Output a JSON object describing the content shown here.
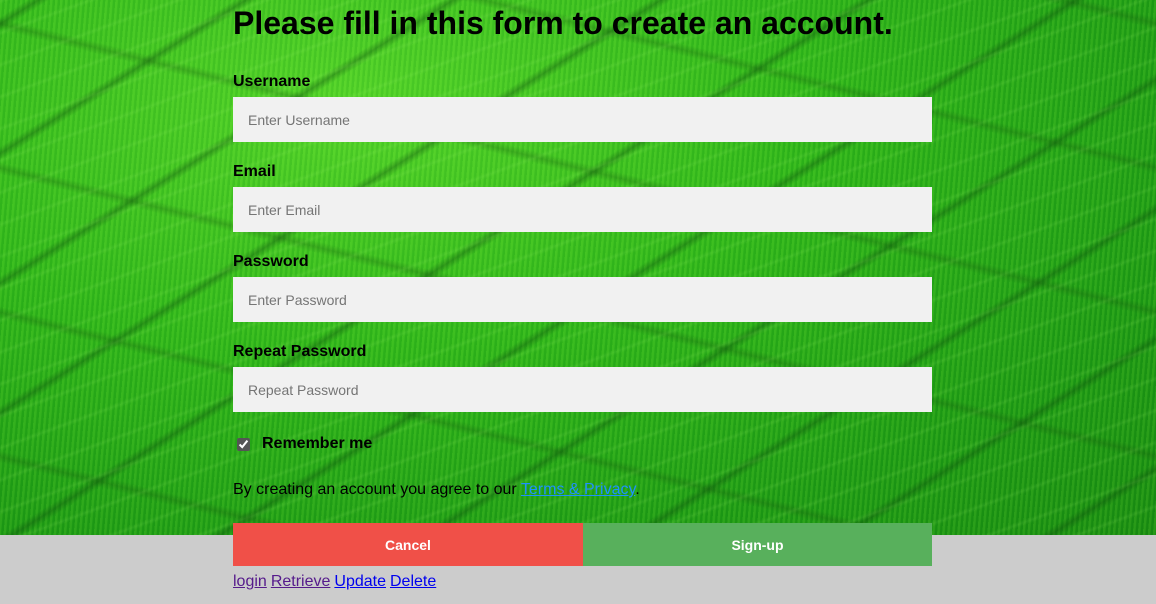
{
  "form": {
    "title": "Please fill in this form to create an account.",
    "fields": [
      {
        "label": "Username",
        "placeholder": "Enter Username",
        "value": ""
      },
      {
        "label": "Email",
        "placeholder": "Enter Email",
        "value": ""
      },
      {
        "label": "Password",
        "placeholder": "Enter Password",
        "value": ""
      },
      {
        "label": "Repeat Password",
        "placeholder": "Repeat Password",
        "value": ""
      }
    ],
    "remember_label": "Remember me",
    "remember_checked": true,
    "terms_text": "By creating an account you agree to our ",
    "terms_link": "Terms & Privacy",
    "terms_suffix": ".",
    "cancel_label": "Cancel",
    "signup_label": "Sign-up"
  },
  "footer_links": [
    {
      "label": "login"
    },
    {
      "label": "Retrieve"
    },
    {
      "label": "Update"
    },
    {
      "label": "Delete"
    }
  ],
  "colors": {
    "cancel": "#f05048",
    "signup": "#58b05c",
    "input_bg": "#f1f1f1",
    "link": "#1e90ff",
    "footer_bg": "#cccccc"
  },
  "icons": {
    "background": "rice-field-image"
  }
}
